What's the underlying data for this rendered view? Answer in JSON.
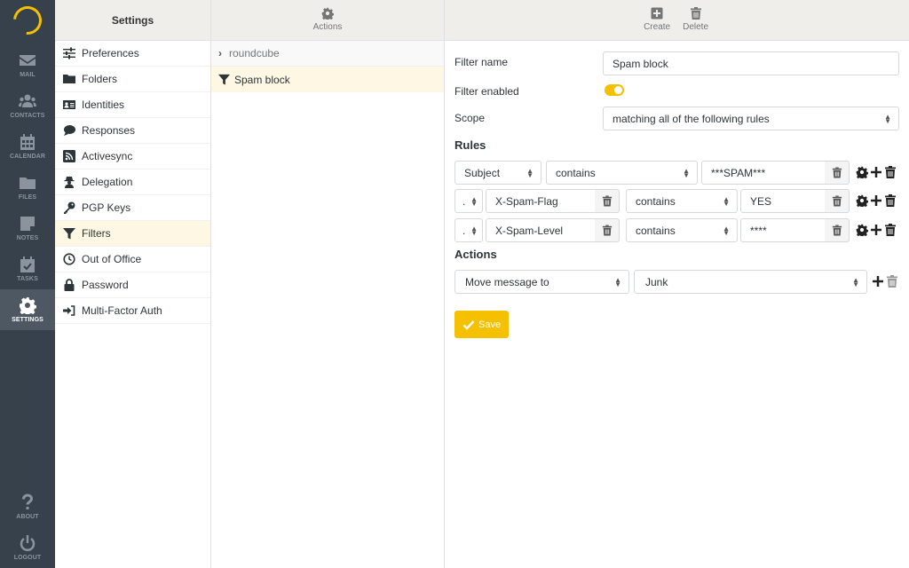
{
  "nav": {
    "items": [
      {
        "label": "MAIL",
        "icon": "envelope-icon"
      },
      {
        "label": "CONTACTS",
        "icon": "users-icon"
      },
      {
        "label": "CALENDAR",
        "icon": "calendar-icon"
      },
      {
        "label": "FILES",
        "icon": "folder-icon"
      },
      {
        "label": "NOTES",
        "icon": "note-icon"
      },
      {
        "label": "TASKS",
        "icon": "tasks-icon"
      },
      {
        "label": "SETTINGS",
        "icon": "gear-icon",
        "active": true
      }
    ],
    "bottom": [
      {
        "label": "ABOUT",
        "icon": "question-icon"
      },
      {
        "label": "LOGOUT",
        "icon": "power-icon"
      }
    ]
  },
  "settings": {
    "title": "Settings",
    "items": [
      {
        "label": "Preferences",
        "icon": "sliders-icon"
      },
      {
        "label": "Folders",
        "icon": "folder-icon"
      },
      {
        "label": "Identities",
        "icon": "id-card-icon"
      },
      {
        "label": "Responses",
        "icon": "comment-icon"
      },
      {
        "label": "Activesync",
        "icon": "rss-icon"
      },
      {
        "label": "Delegation",
        "icon": "user-secret-icon"
      },
      {
        "label": "PGP Keys",
        "icon": "key-icon"
      },
      {
        "label": "Filters",
        "icon": "filter-icon",
        "selected": true
      },
      {
        "label": "Out of Office",
        "icon": "clock-icon"
      },
      {
        "label": "Password",
        "icon": "lock-icon"
      },
      {
        "label": "Multi-Factor Auth",
        "icon": "sign-in-icon"
      }
    ]
  },
  "filters": {
    "actions_label": "Actions",
    "filter_set": "roundcube",
    "selected_filter": "Spam block"
  },
  "toolbar": {
    "create_label": "Create",
    "delete_label": "Delete"
  },
  "form": {
    "filter_name_label": "Filter name",
    "filter_name_value": "Spam block",
    "filter_enabled_label": "Filter enabled",
    "filter_enabled": true,
    "scope_label": "Scope",
    "scope_value": "matching all of the following rules",
    "rules_heading": "Rules",
    "rules": [
      {
        "header": "Subject",
        "operator": "contains",
        "value": "***SPAM***"
      },
      {
        "header": "...",
        "custom_header": "X-Spam-Flag",
        "operator": "contains",
        "value": "YES"
      },
      {
        "header": "...",
        "custom_header": "X-Spam-Level",
        "operator": "contains",
        "value": "****"
      }
    ],
    "actions_heading": "Actions",
    "action": {
      "type": "Move message to",
      "target": "Junk"
    },
    "save_label": "Save"
  },
  "colors": {
    "accent": "#f4c000",
    "nav_bg": "#37414b",
    "selected_row": "#fdf7e3"
  }
}
